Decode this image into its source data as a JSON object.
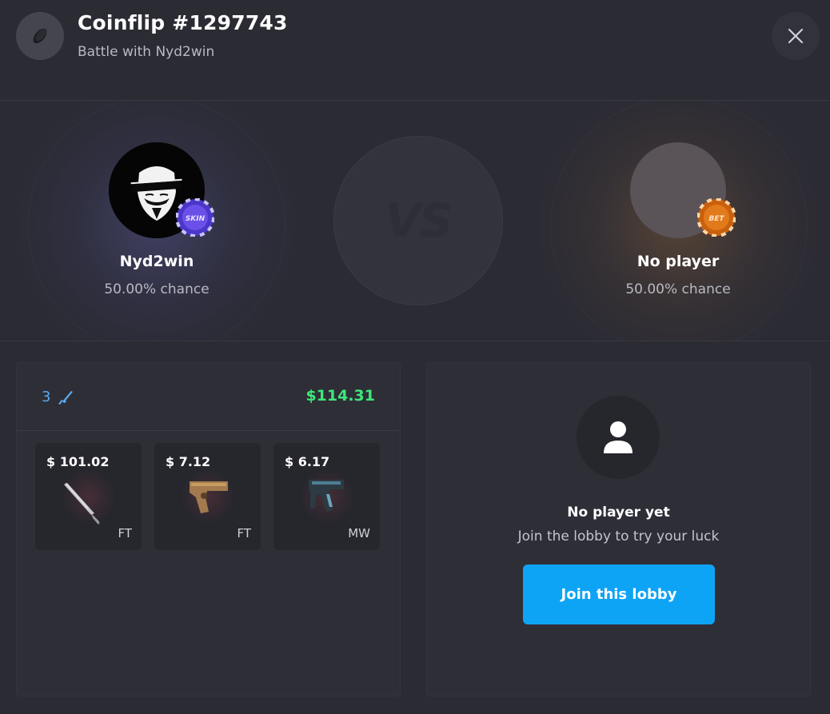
{
  "header": {
    "title": "Coinflip #1297743",
    "subtitle": "Battle with Nyd2win",
    "icon": "coin-icon",
    "close_icon": "close-icon"
  },
  "battle": {
    "vs_label": "VS",
    "left_player": {
      "name": "Nyd2win",
      "chance": "50.00% chance",
      "chip_label": "SKIN",
      "chip_color": "#6a4fe8"
    },
    "right_player": {
      "name": "No player",
      "chance": "50.00% chance",
      "chip_label": "BET",
      "chip_color": "#e27a1c"
    }
  },
  "items_panel": {
    "count": "3",
    "count_icon": "rifle-icon",
    "total": "$114.31",
    "items": [
      {
        "price": "$ 101.02",
        "wear": "FT",
        "icon": "knife-icon"
      },
      {
        "price": "$ 7.12",
        "wear": "FT",
        "icon": "pistol-icon"
      },
      {
        "price": "$ 6.17",
        "wear": "MW",
        "icon": "smg-icon"
      }
    ]
  },
  "join_panel": {
    "icon": "user-icon",
    "title": "No player yet",
    "subtitle": "Join the lobby to try your luck",
    "button_label": "Join this lobby"
  },
  "colors": {
    "background": "#2b2b34",
    "accent": "#0ea4f6",
    "total_green": "#3ee77a",
    "count_blue": "#5aa9f0"
  }
}
